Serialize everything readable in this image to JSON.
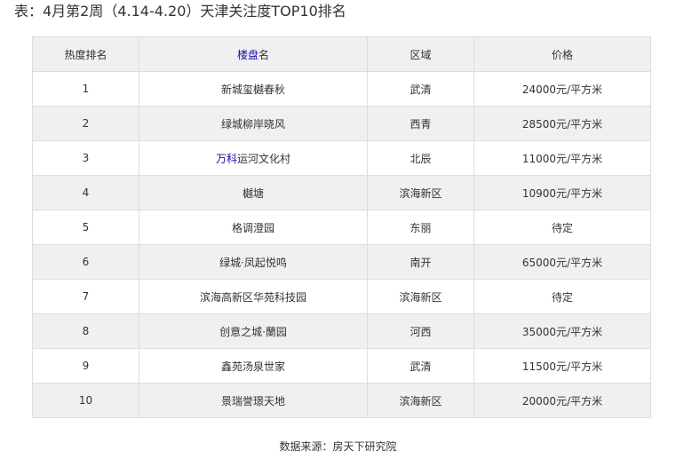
{
  "caption": "表：4月第2周（4.14-4.20）天津关注度TOP10排名",
  "table": {
    "headers": {
      "rank": "热度排名",
      "name_link": "楼盘",
      "name_rest": "名",
      "district": "区域",
      "price": "价格"
    },
    "rows": [
      {
        "rank": "1",
        "name_link": "",
        "name": "新城玺樾春秋",
        "district": "武清",
        "price": "24000元/平方米"
      },
      {
        "rank": "2",
        "name_link": "",
        "name": "绿城柳岸晓风",
        "district": "西青",
        "price": "28500元/平方米"
      },
      {
        "rank": "3",
        "name_link": "万科",
        "name": "运河文化村",
        "district": "北辰",
        "price": "11000元/平方米"
      },
      {
        "rank": "4",
        "name_link": "",
        "name": "樾塘",
        "district": "滨海新区",
        "price": "10900元/平方米"
      },
      {
        "rank": "5",
        "name_link": "",
        "name": "格调澄园",
        "district": "东丽",
        "price": "待定"
      },
      {
        "rank": "6",
        "name_link": "",
        "name": "绿城·凤起悦鸣",
        "district": "南开",
        "price": "65000元/平方米"
      },
      {
        "rank": "7",
        "name_link": "",
        "name": "滨海高新区华苑科技园",
        "district": "滨海新区",
        "price": "待定"
      },
      {
        "rank": "8",
        "name_link": "",
        "name": "创意之城·蘭园",
        "district": "河西",
        "price": "35000元/平方米"
      },
      {
        "rank": "9",
        "name_link": "",
        "name": "鑫苑汤泉世家",
        "district": "武清",
        "price": "11500元/平方米"
      },
      {
        "rank": "10",
        "name_link": "",
        "name": "景瑞誉璟天地",
        "district": "滨海新区",
        "price": "20000元/平方米"
      }
    ]
  },
  "source": "数据来源：房天下研究院"
}
